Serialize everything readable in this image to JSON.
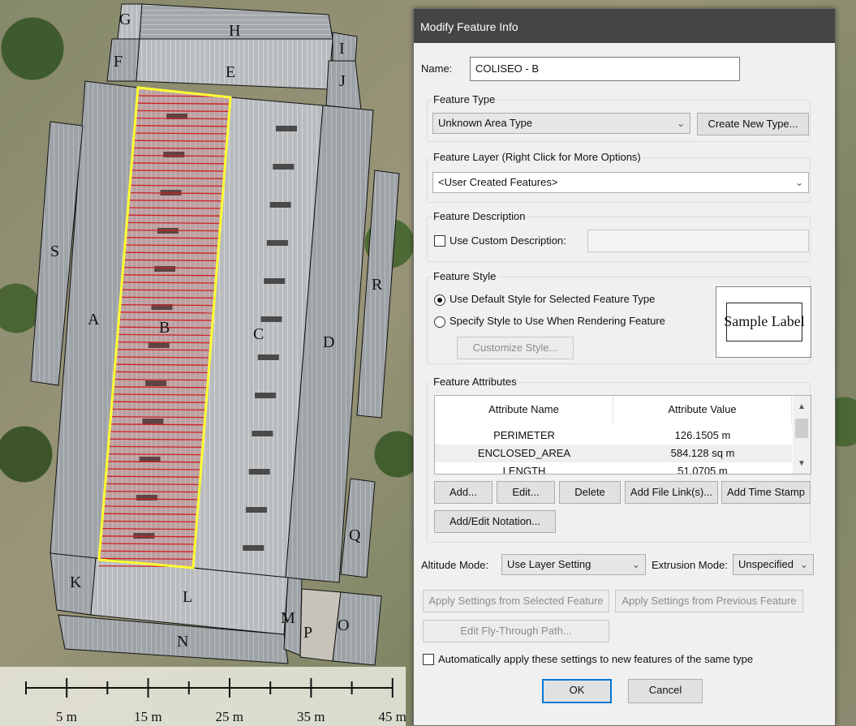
{
  "map": {
    "building_letters": [
      "G",
      "H",
      "F",
      "E",
      "I",
      "J",
      "S",
      "A",
      "B",
      "C",
      "D",
      "R",
      "Q",
      "K",
      "L",
      "M",
      "P",
      "O",
      "N"
    ],
    "scale_labels": [
      "5 m",
      "15 m",
      "25 m",
      "35 m",
      "45 m"
    ],
    "colors": {
      "selection_outline": "#ffff33",
      "selection_hatch": "#cc2222",
      "roof": "#a9adb0"
    }
  },
  "dialog": {
    "title": "Modify Feature Info",
    "name_label": "Name:",
    "name_value": "COLISEO - B",
    "feature_type": {
      "group_label": "Feature Type",
      "selected": "Unknown Area Type",
      "create_new_button": "Create New Type..."
    },
    "feature_layer": {
      "group_label": "Feature Layer (Right Click for More Options)",
      "selected": "<User Created Features>"
    },
    "feature_description": {
      "group_label": "Feature Description",
      "checkbox_label": "Use Custom Description:",
      "checked": false,
      "value": ""
    },
    "feature_style": {
      "group_label": "Feature Style",
      "option_default": "Use Default Style for Selected Feature Type",
      "option_specify": "Specify Style to Use When Rendering Feature",
      "selected_option": "default",
      "customize_button": "Customize Style...",
      "sample_label": "Sample Label"
    },
    "feature_attributes": {
      "group_label": "Feature Attributes",
      "columns": [
        "Attribute Name",
        "Attribute Value"
      ],
      "rows": [
        {
          "name": "PERIMETER",
          "value": "126.1505 m"
        },
        {
          "name": "ENCLOSED_AREA",
          "value": "584.128 sq m"
        },
        {
          "name": "LENGTH",
          "value": "51.0705 m"
        }
      ],
      "selected_row": 1,
      "buttons": {
        "add": "Add...",
        "edit": "Edit...",
        "delete": "Delete",
        "add_file_links": "Add File Link(s)...",
        "add_time_stamp": "Add Time Stamp",
        "add_edit_notation": "Add/Edit Notation..."
      }
    },
    "altitude_mode": {
      "label": "Altitude Mode:",
      "value": "Use Layer Setting"
    },
    "extrusion_mode": {
      "label": "Extrusion Mode:",
      "value": "Unspecified"
    },
    "apply_selected_button": "Apply Settings from Selected Feature",
    "apply_previous_button": "Apply Settings from Previous Feature",
    "fly_through_button": "Edit Fly-Through Path...",
    "auto_apply_label": "Automatically apply these settings to new features of the same type",
    "auto_apply_checked": false,
    "ok_button": "OK",
    "cancel_button": "Cancel"
  }
}
